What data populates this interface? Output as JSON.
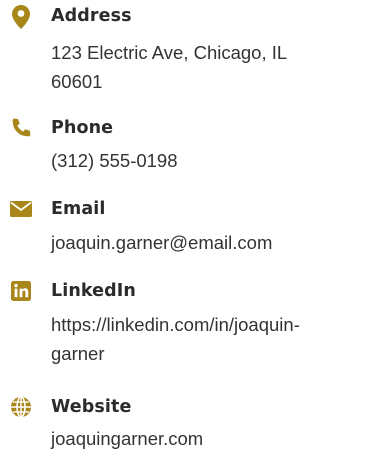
{
  "accent_color": "#a8861a",
  "contacts": [
    {
      "icon": "map-pin-icon",
      "label": "Address",
      "value": "123 Electric Ave, Chicago, IL\n60601"
    },
    {
      "icon": "phone-icon",
      "label": "Phone",
      "value": "(312) 555-0198"
    },
    {
      "icon": "envelope-icon",
      "label": "Email",
      "value": "joaquin.garner@email.com"
    },
    {
      "icon": "linkedin-icon",
      "label": "LinkedIn",
      "value": "https://linkedin.com/in/joaquin-\ngarner"
    },
    {
      "icon": "globe-icon",
      "label": "Website",
      "value": "joaquingarner.com"
    }
  ]
}
